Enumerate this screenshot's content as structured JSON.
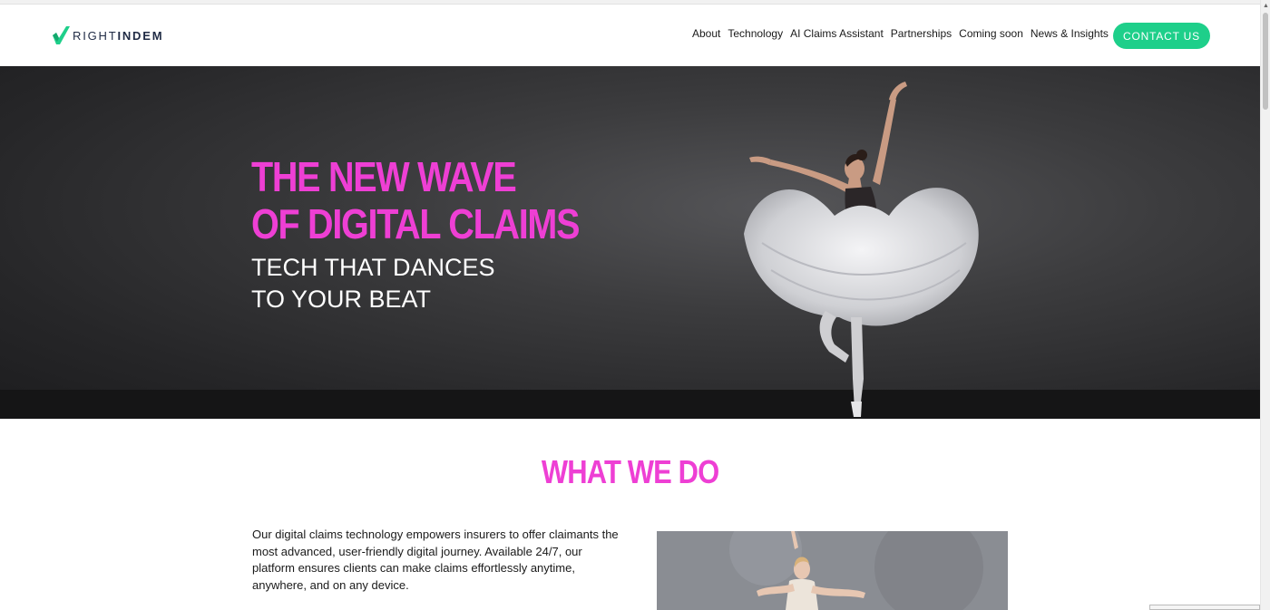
{
  "brand": {
    "logo_light": "RIGHT",
    "logo_bold": "INDEM",
    "logo_icon": "checkmark-logo-icon",
    "colors": {
      "accent_green": "#1ecf8a",
      "pink": "#ee3fd4",
      "navy": "#1f2a44"
    }
  },
  "nav": {
    "items": [
      {
        "label": "About"
      },
      {
        "label": "Technology"
      },
      {
        "label": "AI Claims Assistant"
      },
      {
        "label": "Partnerships"
      },
      {
        "label": "Coming soon"
      },
      {
        "label": "News & Insights"
      }
    ],
    "contact_label": "CONTACT US"
  },
  "hero": {
    "title_line1": "THE NEW WAVE",
    "title_line2": "OF DIGITAL CLAIMS",
    "sub_line1": "TECH THAT DANCES",
    "sub_line2": "TO YOUR BEAT"
  },
  "what_we_do": {
    "heading": "WHAT WE DO",
    "body": "Our digital claims technology empowers insurers to offer claimants the most advanced, user-friendly digital journey. Available 24/7, our platform ensures clients can make claims effortlessly anytime, anywhere, and on any device."
  }
}
